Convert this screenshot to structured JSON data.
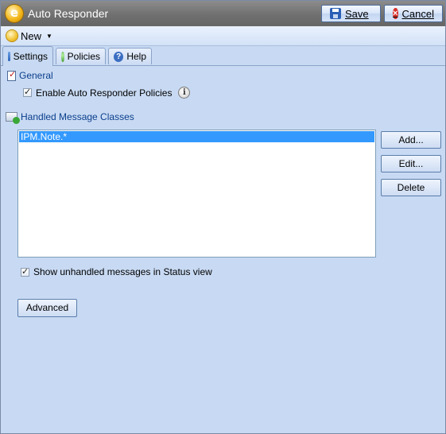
{
  "window": {
    "title": "Auto Responder"
  },
  "toolbar": {
    "save_label": "Save",
    "cancel_label": "Cancel"
  },
  "menu": {
    "new_label": "New"
  },
  "tabs": [
    {
      "label": "Settings",
      "icon": "settings-icon",
      "active": true
    },
    {
      "label": "Policies",
      "icon": "policies-icon",
      "active": false
    },
    {
      "label": "Help",
      "icon": "help-icon",
      "active": false
    }
  ],
  "general": {
    "heading": "General",
    "enable_label": "Enable Auto Responder Policies",
    "enable_checked": true
  },
  "handled": {
    "heading": "Handled Message Classes",
    "items": [
      "IPM.Note.*"
    ],
    "selected_index": 0,
    "add_label": "Add...",
    "edit_label": "Edit...",
    "delete_label": "Delete",
    "show_unhandled_label": "Show unhandled messages in Status view",
    "show_unhandled_checked": true
  },
  "advanced_label": "Advanced"
}
